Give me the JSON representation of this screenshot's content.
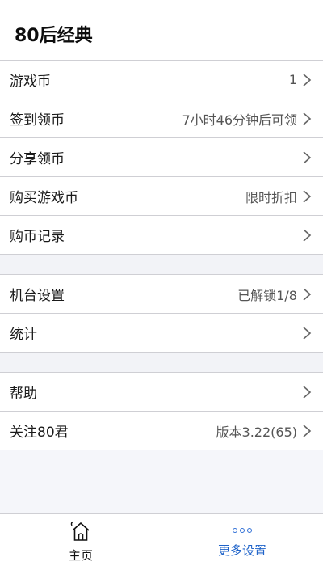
{
  "header": {
    "title": "80后经典"
  },
  "groups": [
    {
      "items": [
        {
          "label": "游戏币",
          "value": "1"
        },
        {
          "label": "签到领币",
          "value": "7小时46分钟后可领"
        },
        {
          "label": "分享领币",
          "value": ""
        },
        {
          "label": "购买游戏币",
          "value": "限时折扣"
        },
        {
          "label": "购币记录",
          "value": ""
        }
      ]
    },
    {
      "items": [
        {
          "label": "机台设置",
          "value": "已解锁1/8"
        },
        {
          "label": "统计",
          "value": ""
        }
      ]
    },
    {
      "items": [
        {
          "label": "帮助",
          "value": ""
        },
        {
          "label": "关注80君",
          "value": "版本3.22(65)"
        }
      ]
    }
  ],
  "tabbar": {
    "home": {
      "label": "主页",
      "icon": "home-icon"
    },
    "more": {
      "label": "更多设置",
      "icon": "more-dots-icon"
    }
  },
  "colors": {
    "accent": "#1f63c9",
    "divider": "#cfcfd4",
    "background": "#f5f6fa"
  }
}
